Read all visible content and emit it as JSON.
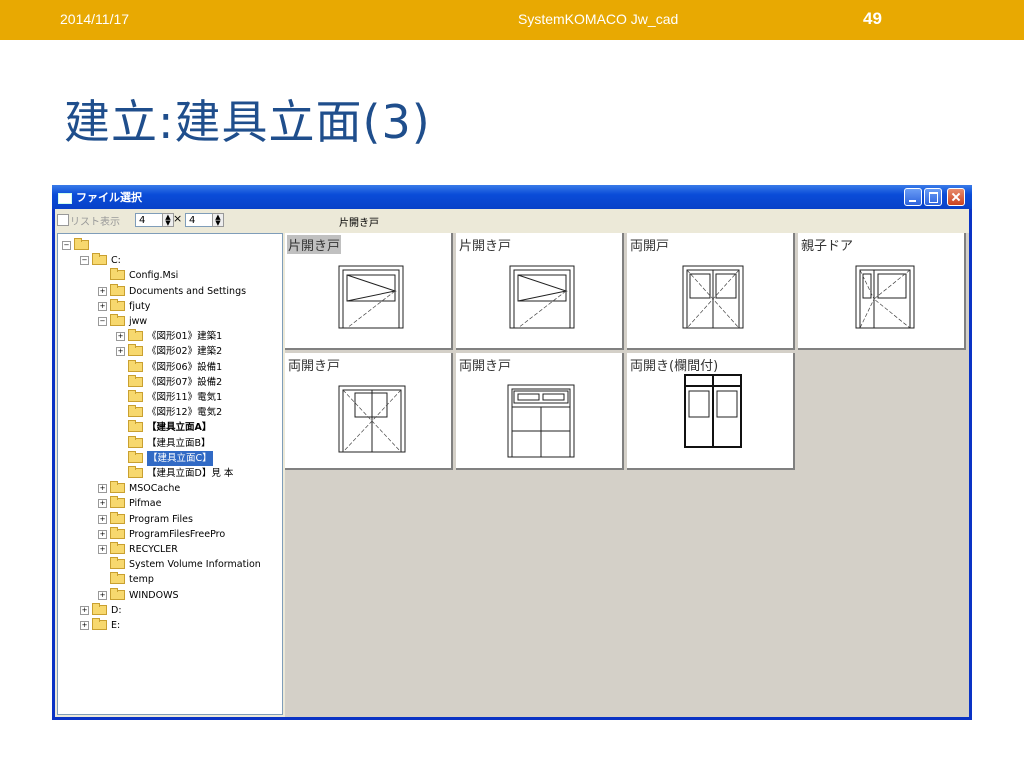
{
  "slide": {
    "date": "2014/11/17",
    "center_title": "SystemKOMACO Jw_cad",
    "page_number": "49",
    "title": "建立:建具立面(3)",
    "accent_color": "#E8A902",
    "title_color": "#1F4E8C"
  },
  "window": {
    "title": "ファイル選択",
    "toolbar": {
      "list_view_label": "リスト表示",
      "cols_value": "4",
      "times": "×",
      "rows_value": "4",
      "current_file": "片開き戸"
    },
    "tree": [
      {
        "text": "",
        "pm": "−"
      },
      {
        "text": "C:",
        "pm": "−"
      },
      {
        "text": "Config.Msi",
        "pm": ""
      },
      {
        "text": "Documents and Settings",
        "pm": "+"
      },
      {
        "text": "fjuty",
        "pm": "+"
      },
      {
        "text": "jww",
        "pm": "−"
      },
      {
        "text": "《図形01》建築1",
        "pm": "+"
      },
      {
        "text": "《図形02》建築2",
        "pm": "+"
      },
      {
        "text": "《図形06》設備1",
        "pm": ""
      },
      {
        "text": "《図形07》設備2",
        "pm": ""
      },
      {
        "text": "《図形11》電気1",
        "pm": ""
      },
      {
        "text": "《図形12》電気2",
        "pm": ""
      },
      {
        "text": "【建具立面A】",
        "pm": "",
        "bold": true
      },
      {
        "text": "【建具立面B】",
        "pm": ""
      },
      {
        "text": "【建具立面C】",
        "pm": "",
        "selected": true
      },
      {
        "text": "【建具立面D】見 本",
        "pm": ""
      },
      {
        "text": "MSOCache",
        "pm": "+"
      },
      {
        "text": "Pifmae",
        "pm": "+"
      },
      {
        "text": "Program Files",
        "pm": "+"
      },
      {
        "text": "ProgramFilesFreePro",
        "pm": "+"
      },
      {
        "text": "RECYCLER",
        "pm": "+"
      },
      {
        "text": "System Volume Information",
        "pm": ""
      },
      {
        "text": "temp",
        "pm": ""
      },
      {
        "text": "WINDOWS",
        "pm": "+"
      },
      {
        "text": "D:",
        "pm": "+"
      },
      {
        "text": "E:",
        "pm": "+"
      }
    ],
    "thumbnails": [
      {
        "label": "片開き戸",
        "highlight": true,
        "kind": "single"
      },
      {
        "label": "片開き戸",
        "highlight": false,
        "kind": "single2"
      },
      {
        "label": "両開戸",
        "highlight": false,
        "kind": "double"
      },
      {
        "label": "親子ドア",
        "highlight": false,
        "kind": "parent"
      },
      {
        "label": "両開き戸",
        "highlight": false,
        "kind": "double2"
      },
      {
        "label": "両開き戸",
        "highlight": false,
        "kind": "transom"
      },
      {
        "label": "両開き(欄間付)",
        "highlight": false,
        "kind": "transom2"
      }
    ]
  }
}
